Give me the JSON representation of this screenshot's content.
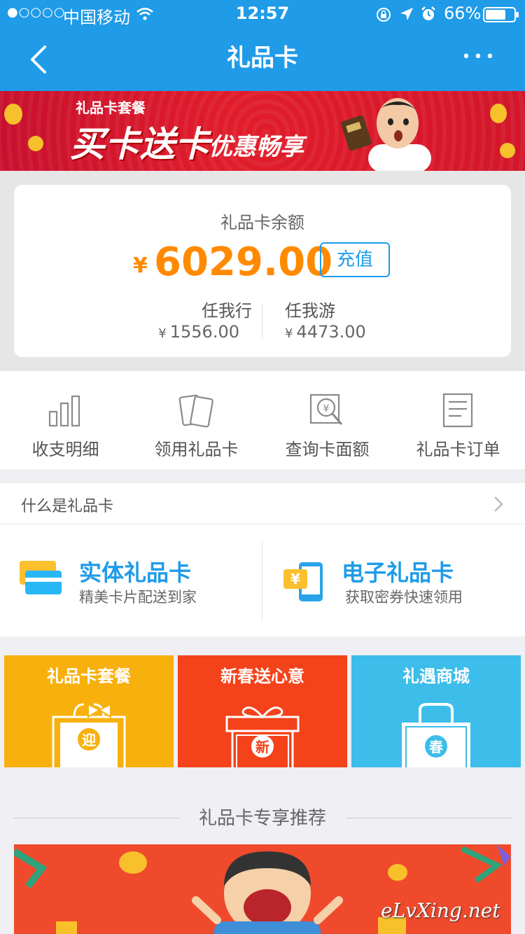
{
  "status_bar": {
    "signal_dots": "●○○○○",
    "carrier": "中国移动",
    "time": "12:57",
    "battery": "66%"
  },
  "nav": {
    "title": "礼品卡",
    "more": "•••"
  },
  "banner": {
    "tag": "礼品卡套餐",
    "headline": "买卡送卡",
    "sub": "优惠畅享"
  },
  "balance": {
    "label": "礼品卡余额",
    "currency": "¥",
    "amount": "6029.00",
    "recharge_label": "充值",
    "sub_accounts": [
      {
        "name": "任我行",
        "currency": "¥",
        "amount": "1556.00"
      },
      {
        "name": "任我游",
        "currency": "¥",
        "amount": "4473.00"
      }
    ]
  },
  "shortcuts": [
    {
      "label": "收支明细",
      "icon": "bar-chart-icon"
    },
    {
      "label": "领用礼品卡",
      "icon": "cards-icon"
    },
    {
      "label": "查询卡面额",
      "icon": "yuan-search-icon"
    },
    {
      "label": "礼品卡订单",
      "icon": "document-icon"
    }
  ],
  "what_is": {
    "label": "什么是礼品卡"
  },
  "card_types": [
    {
      "title": "实体礼品卡",
      "desc": "精美卡片配送到家",
      "icon": "physical-card-icon"
    },
    {
      "title": "电子礼品卡",
      "desc": "获取密券快速领用",
      "icon": "phone-card-icon",
      "badge": "¥"
    }
  ],
  "tiles": [
    {
      "title": "礼品卡套餐",
      "badge": "迎",
      "color": "#f8b00d"
    },
    {
      "title": "新春送心意",
      "badge": "新",
      "color": "#f4421a"
    },
    {
      "title": "礼遇商城",
      "badge": "春",
      "color": "#3dbde9"
    }
  ],
  "recommend": {
    "title": "礼品卡专享推荐",
    "watermark": "eLvXing.net"
  },
  "colors": {
    "nav_blue": "#1f9be8",
    "amount_orange": "#ff8a00",
    "accent_blue": "#1f9be8"
  }
}
